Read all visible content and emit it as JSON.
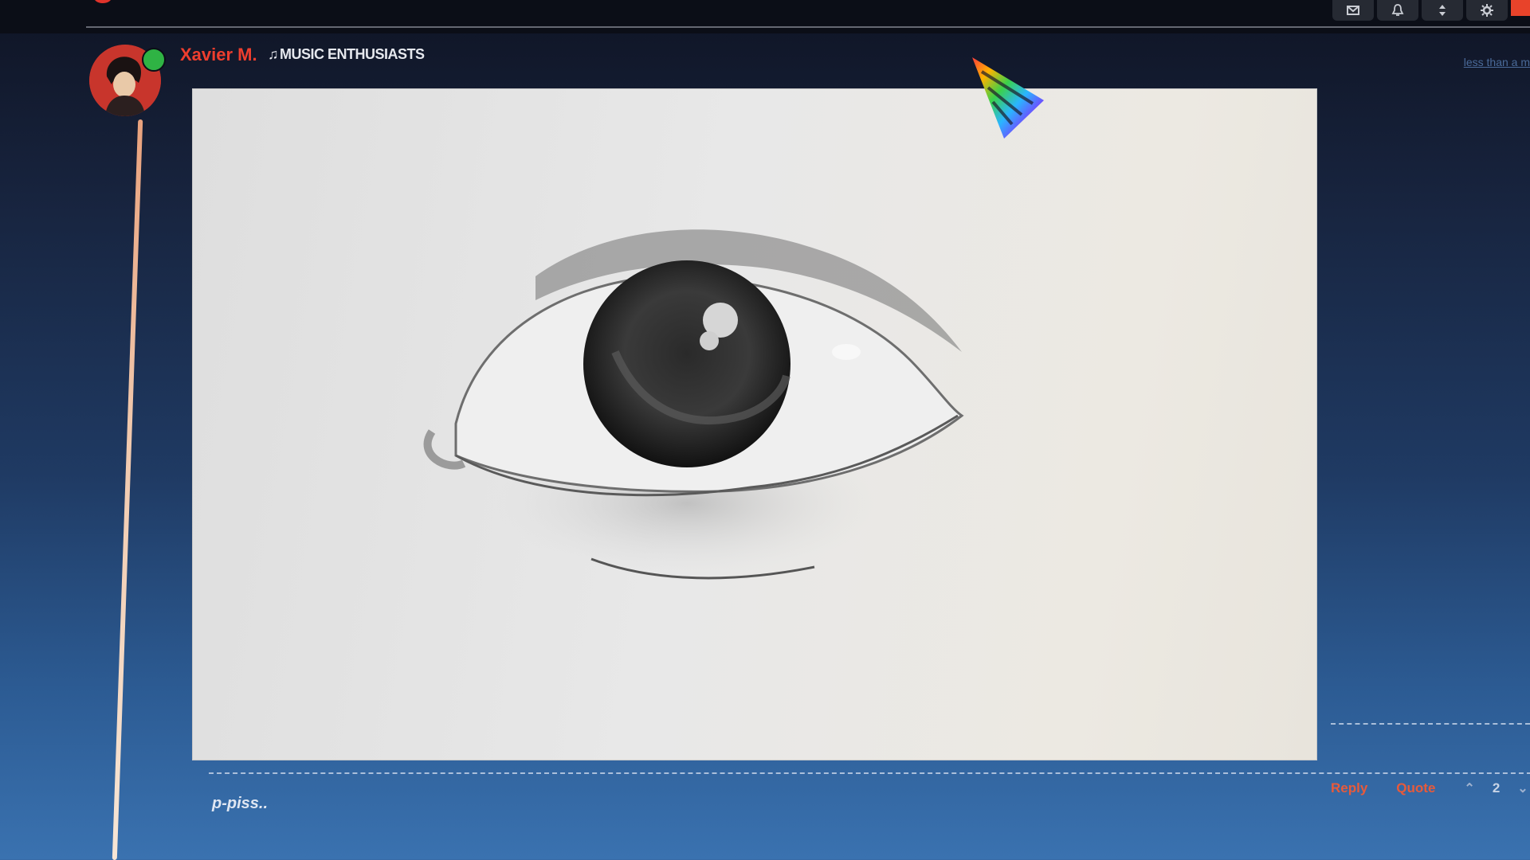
{
  "post": {
    "author": "Xavier M.",
    "badge_icon": "music-note-icon",
    "badge_label": "MUSIC ENTHUSIASTS",
    "timestamp": "less than a m",
    "text": "p-piss..",
    "online": true
  },
  "actions": {
    "reply": "Reply",
    "quote": "Quote",
    "vote_count": "2"
  },
  "topbar": {
    "icons": [
      "inbox-icon",
      "bell-icon",
      "sort-icon",
      "gear-icon"
    ]
  },
  "colors": {
    "author": "#ee3e2e",
    "action": "#e85a3a",
    "online": "#2fb344"
  }
}
